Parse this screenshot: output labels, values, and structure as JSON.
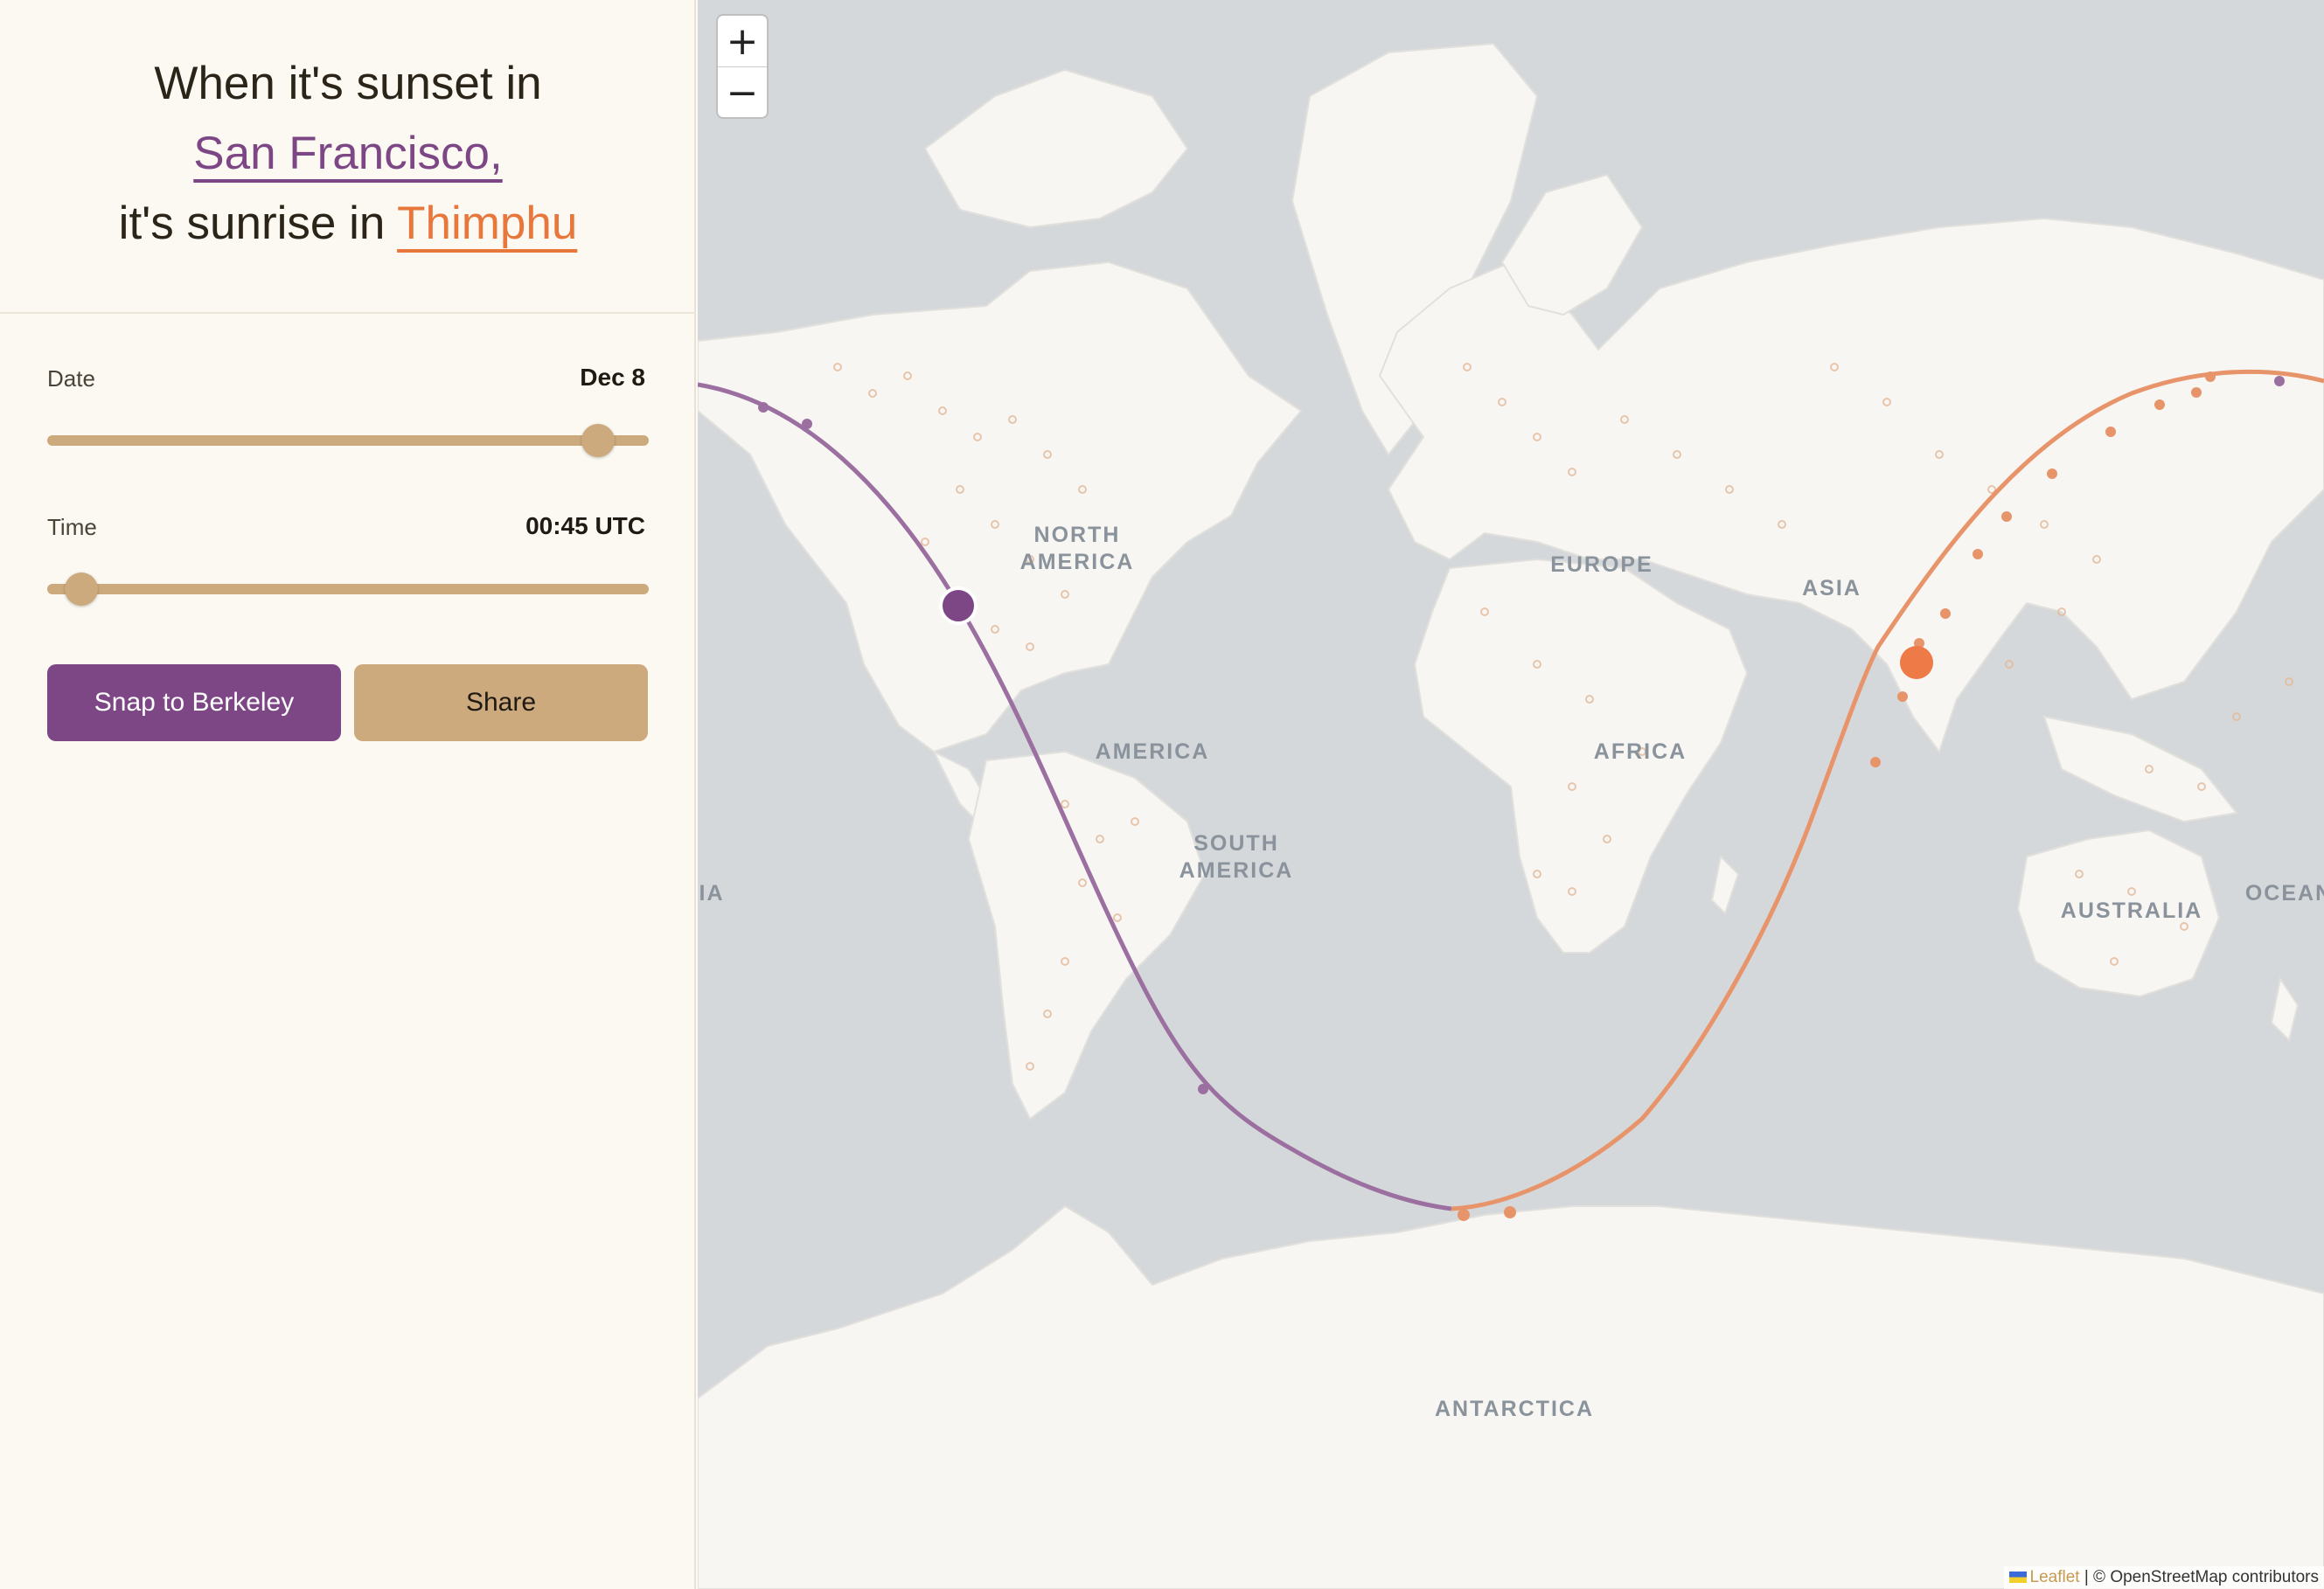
{
  "headline": {
    "line1": "When it's sunset in",
    "sunset_city": "San Francisco,",
    "line3_prefix": "it's sunrise in ",
    "sunrise_city": "Thimphu"
  },
  "controls": {
    "date": {
      "label": "Date",
      "value": "Dec 8",
      "slider_fraction": 0.94
    },
    "time": {
      "label": "Time",
      "value": "00:45 UTC",
      "slider_fraction": 0.03
    }
  },
  "buttons": {
    "snap_label": "Snap to Berkeley",
    "share_label": "Share"
  },
  "map": {
    "zoom_in": "+",
    "zoom_out": "−",
    "region_labels": [
      "NORTH",
      "AMERICA",
      "AMERICA",
      "SOUTH",
      "AMERICA",
      "EUROPE",
      "ASIA",
      "AFRICA",
      "AUSTRALIA",
      "OCEAN",
      "IA",
      "ANTARCTICA"
    ],
    "attribution": {
      "leaflet": "Leaflet",
      "rest": " | © OpenStreetMap contributors"
    },
    "colors": {
      "sunset": "#7d4786",
      "sunrise": "#e8773c",
      "water": "#d5d8da",
      "land": "#f7f6f3",
      "dots": "#e2b99a"
    }
  }
}
